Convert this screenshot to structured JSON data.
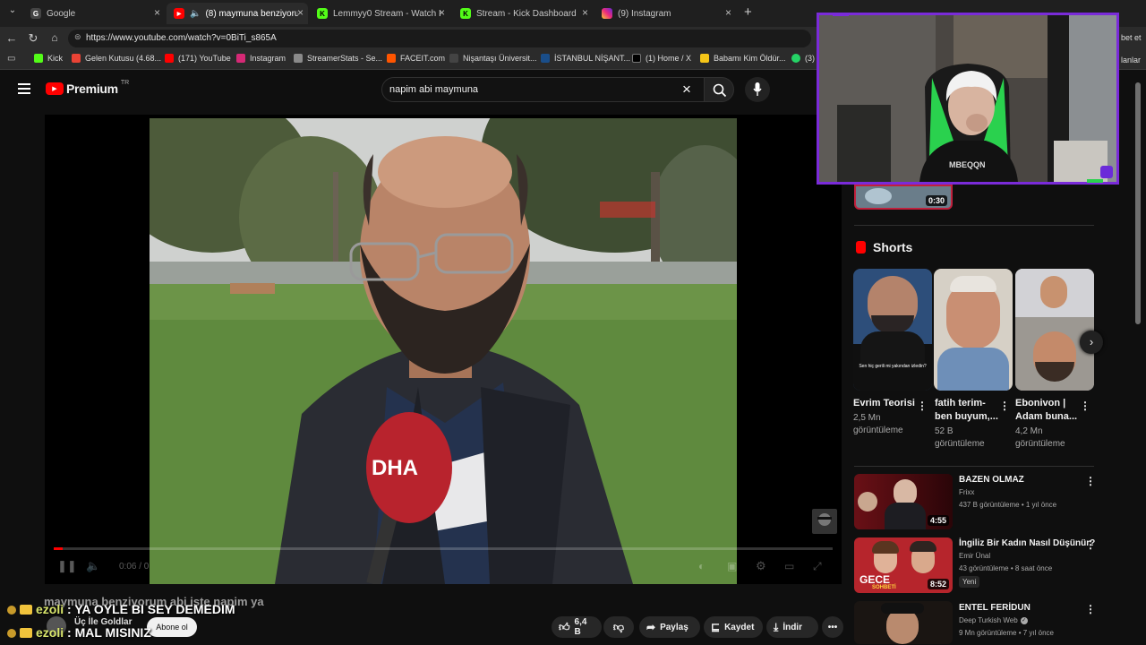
{
  "browser": {
    "tabs": [
      {
        "label": "Google",
        "favicon": "google-icon"
      },
      {
        "label": "(8) maymuna benziyorum abi",
        "favicon": "youtube-icon",
        "active": true
      },
      {
        "label": "Lemmyy0 Stream - Watch Live on",
        "favicon": "kick-icon"
      },
      {
        "label": "Stream - Kick Dashboard",
        "favicon": "kick-icon"
      },
      {
        "label": "(9) Instagram",
        "favicon": "instagram-icon"
      }
    ],
    "url": "https://www.youtube.com/watch?v=0BiTi_s865A",
    "bookmarks": [
      {
        "label": "Kick",
        "color": "#53fc18"
      },
      {
        "label": "Gelen Kutusu (4.68...",
        "color": "#ea4335"
      },
      {
        "label": "(171) YouTube",
        "color": "#ff0000"
      },
      {
        "label": "Instagram",
        "color": "#d62976"
      },
      {
        "label": "StreamerStats - Se...",
        "color": "#8a8a8a"
      },
      {
        "label": "FACEIT.com",
        "color": "#ff5500"
      },
      {
        "label": "Nişantaşı Üniversit...",
        "color": "#444444"
      },
      {
        "label": "İSTANBUL NİŞANT...",
        "color": "#1a4e8a"
      },
      {
        "label": "(1) Home / X",
        "color": "#000000"
      },
      {
        "label": "Babamı Kim Öldür...",
        "color": "#f5c518"
      },
      {
        "label": "(3)",
        "color": "#25d366"
      }
    ],
    "right_cut_1": "bet et",
    "right_cut_2": "lanlar"
  },
  "youtube": {
    "logo_text": "Premium",
    "logo_region": "TR",
    "search_query": "napim abi maymuna",
    "video": {
      "caption": "maymuna benziyorum abi işte napim ya",
      "time": "0:06 / 0",
      "watermark": "DHA",
      "mic_label": "DHA"
    },
    "channel_name": "Üç İle Goldlar",
    "subscribe_label": "Abone ol",
    "actions": {
      "likes": "6,4 B",
      "share": "Paylaş",
      "save": "Kaydet",
      "download": "İndir"
    },
    "top_thumb_duration": "0:30",
    "shorts_title": "Shorts",
    "shorts": [
      {
        "title_1": "Evrim Teorisi",
        "title_2": "",
        "views_1": "2,5 Mn",
        "views_2": "görüntüleme",
        "caption": "Sen hiç gerili mi yakından izledin?"
      },
      {
        "title_1": "fatih terim-",
        "title_2": "ben buyum,...",
        "views_1": "52 B",
        "views_2": "görüntüleme"
      },
      {
        "title_1": "Ebonivon |",
        "title_2": "Adam buna...",
        "views_1": "4,2 Mn",
        "views_2": "görüntüleme"
      }
    ],
    "related": [
      {
        "title": "BAZEN OLMAZ",
        "channel": "Frixx",
        "meta": "437 B görüntüleme • 1 yıl önce",
        "duration": "4:55"
      },
      {
        "title": "İngiliz Bir Kadın Nasıl Düşünür?",
        "channel": "Emir Ünal",
        "meta": "43 görüntüleme • 8 saat önce",
        "badge": "Yeni",
        "duration": "8:52",
        "thumb_text": "GECE",
        "thumb_sub": "SOHBETİ"
      },
      {
        "title": "ENTEL FERİDUN",
        "channel": "Deep Turkish Web",
        "meta": "9 Mn görüntüleme • 7 yıl önce"
      }
    ]
  },
  "stream_chat": [
    {
      "user": "ezoli",
      "message": "YA OYLE BI SEY DEMEDIM"
    },
    {
      "user": "ezoli",
      "message": "MAL MISINIZ"
    }
  ],
  "webcam": {
    "shirt_text": "MBEQQN"
  }
}
